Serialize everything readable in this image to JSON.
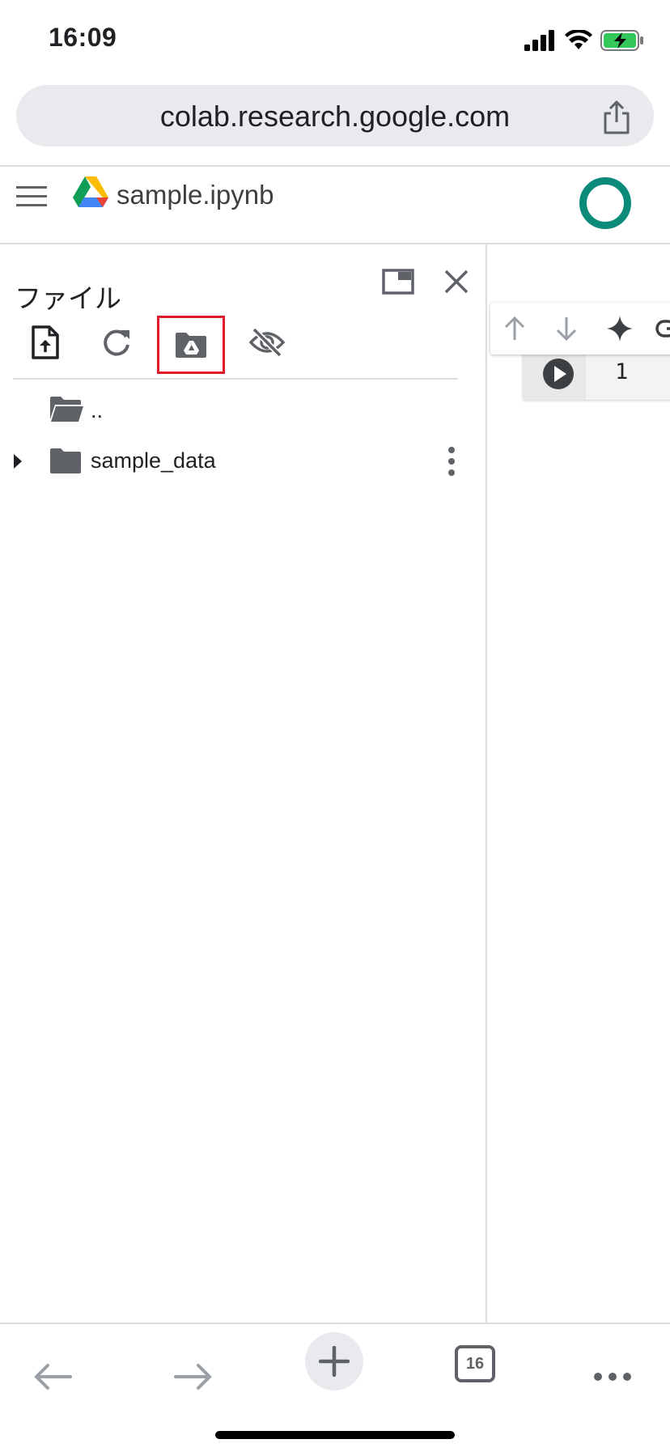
{
  "status_bar": {
    "time": "16:09"
  },
  "browser": {
    "url": "colab.research.google.com",
    "tab_count": "16"
  },
  "header": {
    "notebook_title": "sample.ipynb"
  },
  "files_panel": {
    "title": "ファイル",
    "tree": [
      {
        "label": "..",
        "icon": "folder-open-icon"
      },
      {
        "label": "sample_data",
        "icon": "folder-icon"
      }
    ]
  },
  "notebook": {
    "cell_line_number": "1"
  },
  "colors": {
    "accent_highlight": "#e0182b",
    "account_ring": "#0c8a7a",
    "icon_gray": "#5f6368"
  }
}
